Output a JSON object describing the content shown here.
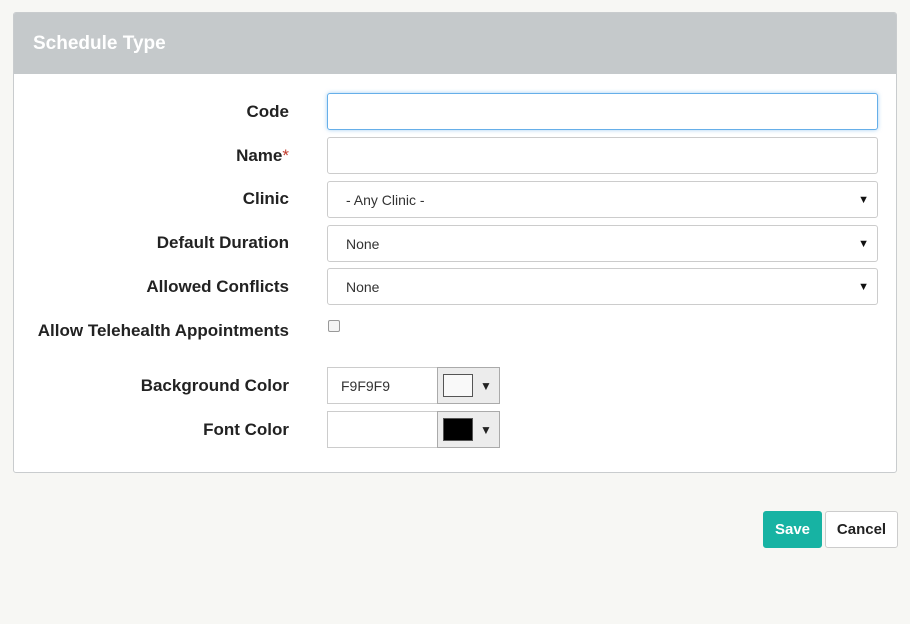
{
  "panel": {
    "title": "Schedule Type"
  },
  "form": {
    "code": {
      "label": "Code",
      "value": ""
    },
    "name": {
      "label": "Name",
      "required_mark": "*",
      "value": ""
    },
    "clinic": {
      "label": "Clinic",
      "selected": "- Any Clinic -"
    },
    "default_duration": {
      "label": "Default Duration",
      "selected": "None"
    },
    "allowed_conflicts": {
      "label": "Allowed Conflicts",
      "selected": "None"
    },
    "telehealth": {
      "label": "Allow Telehealth Appointments",
      "checked": false
    },
    "background_color": {
      "label": "Background Color",
      "value": "F9F9F9",
      "swatch": "#F9F9F9"
    },
    "font_color": {
      "label": "Font Color",
      "value": "",
      "swatch": "#000000"
    }
  },
  "icons": {
    "select_caret": "caret-down-icon",
    "caret_glyph": "▼"
  },
  "actions": {
    "save_label": "Save",
    "cancel_label": "Cancel"
  },
  "colors": {
    "header_bg": "#c5c9cb",
    "save_bg": "#17b3a3",
    "required": "#c0392b",
    "focus": "#66afe9"
  }
}
